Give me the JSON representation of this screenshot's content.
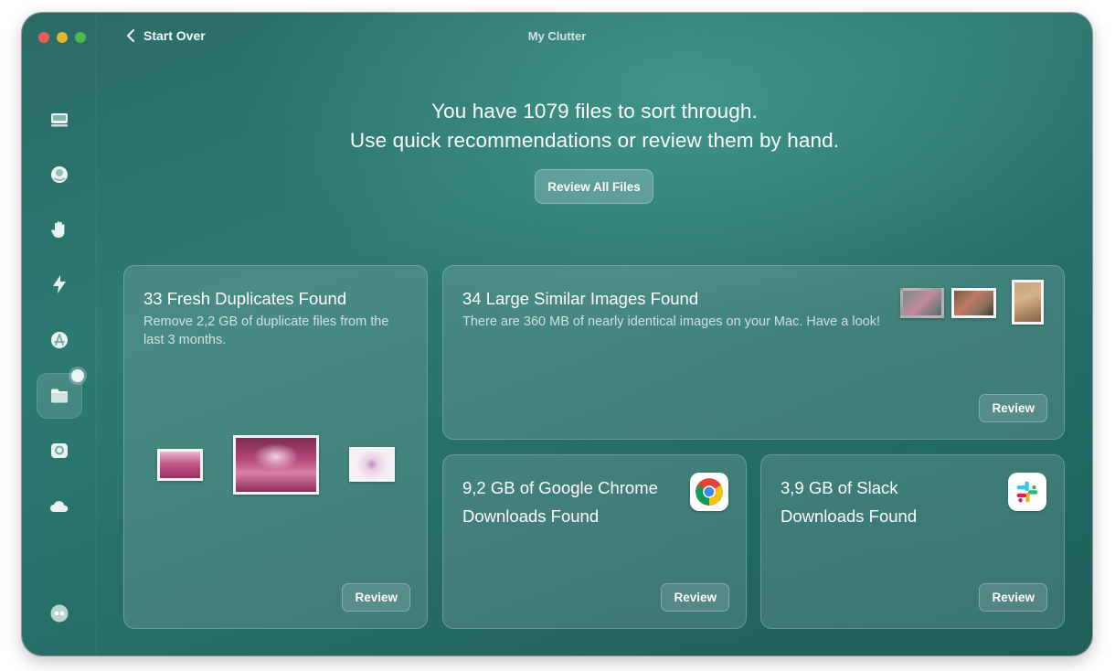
{
  "window": {
    "title": "My Clutter"
  },
  "nav": {
    "back_label": "Start Over"
  },
  "sidebar": {
    "items": [
      {
        "icon": "hard-drive-icon"
      },
      {
        "icon": "protection-icon"
      },
      {
        "icon": "hand-icon"
      },
      {
        "icon": "lightning-icon"
      },
      {
        "icon": "applications-icon"
      },
      {
        "icon": "folder-icon",
        "active": true
      },
      {
        "icon": "space-lens-icon"
      },
      {
        "icon": "cloud-icon"
      },
      {
        "icon": "assistant-icon"
      }
    ]
  },
  "header": {
    "line1": "You have 1079 files to sort through.",
    "line2": "Use quick recommendations or review them by hand.",
    "review_all_label": "Review All Files"
  },
  "cards": {
    "duplicates": {
      "title": "33 Fresh Duplicates Found",
      "description": "Remove 2,2 GB of duplicate files from the last 3 months.",
      "button": "Review"
    },
    "similar_images": {
      "title": "34 Large Similar Images Found",
      "description": "There are 360 MB of nearly identical images on your Mac. Have a look!",
      "button": "Review"
    },
    "chrome": {
      "title": "9,2 GB of Google Chrome Downloads Found",
      "button": "Review"
    },
    "slack": {
      "title": "3,9 GB of Slack Downloads Found",
      "button": "Review"
    }
  },
  "colors": {
    "window_bg": "#2d7a72",
    "chrome_red": "#db4437",
    "chrome_yellow": "#f4c20d",
    "chrome_green": "#0f9d58",
    "chrome_blue": "#4285f4",
    "slack_pink": "#e01e5a",
    "slack_blue": "#36c5f0",
    "slack_green": "#2eb67d",
    "slack_yellow": "#ecb22e"
  }
}
